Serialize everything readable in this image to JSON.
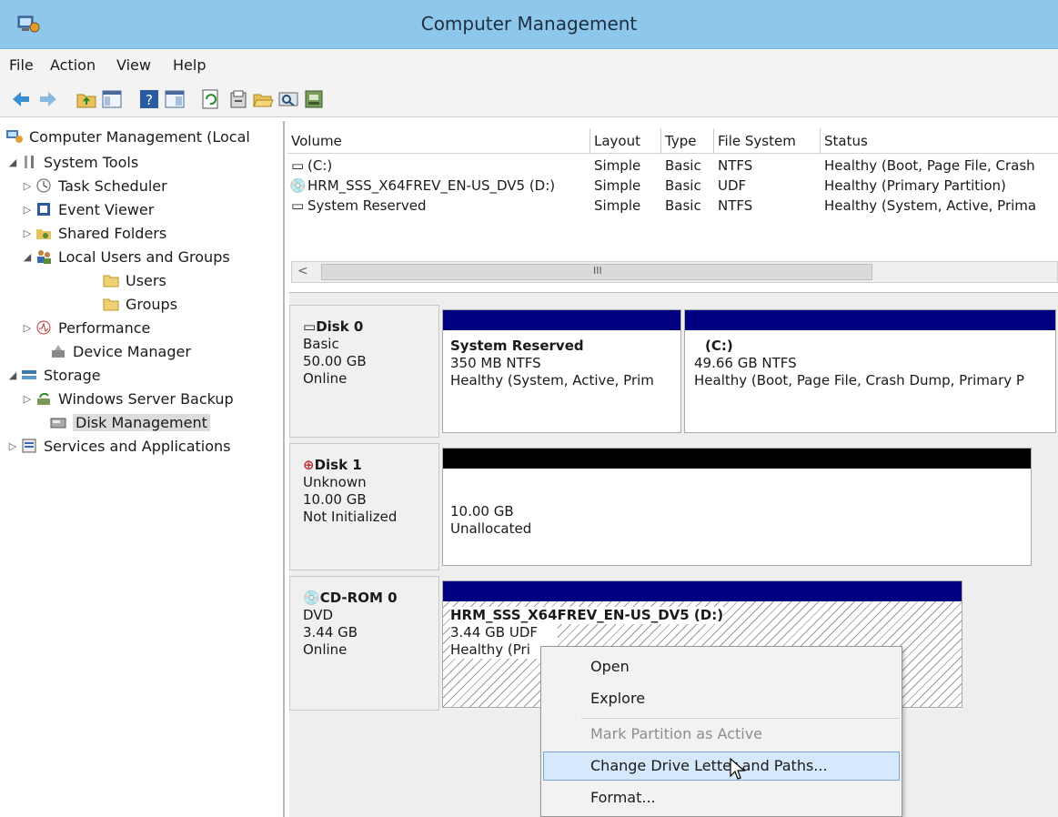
{
  "window": {
    "title": "Computer Management",
    "icon": "computer-management-icon"
  },
  "menu": [
    "File",
    "Action",
    "View",
    "Help"
  ],
  "toolbar": [
    "back-arrow-icon",
    "forward-arrow-icon",
    "up-folder-icon",
    "show-hide-tree-icon",
    "help-icon",
    "properties-pane-icon",
    "refresh-icon",
    "properties-icon",
    "open-icon",
    "search-icon",
    "disk-settings-icon"
  ],
  "tree": [
    {
      "label": "Computer Management (Local",
      "icon": "computer-management-icon",
      "arrow": ""
    },
    {
      "label": "System Tools",
      "icon": "tools-icon",
      "arrow": "expanded"
    },
    {
      "label": "Task Scheduler",
      "icon": "clock-icon",
      "arrow": "collapsed"
    },
    {
      "label": "Event Viewer",
      "icon": "event-viewer-icon",
      "arrow": "collapsed"
    },
    {
      "label": "Shared Folders",
      "icon": "shared-folder-icon",
      "arrow": "collapsed"
    },
    {
      "label": "Local Users and Groups",
      "icon": "users-icon",
      "arrow": "expanded"
    },
    {
      "label": "Users",
      "icon": "folder-icon",
      "arrow": ""
    },
    {
      "label": "Groups",
      "icon": "folder-icon",
      "arrow": ""
    },
    {
      "label": "Performance",
      "icon": "performance-icon",
      "arrow": "collapsed"
    },
    {
      "label": "Device Manager",
      "icon": "device-manager-icon",
      "arrow": ""
    },
    {
      "label": "Storage",
      "icon": "storage-icon",
      "arrow": "expanded"
    },
    {
      "label": "Windows Server Backup",
      "icon": "backup-icon",
      "arrow": "collapsed"
    },
    {
      "label": "Disk Management",
      "icon": "disk-management-icon",
      "arrow": "",
      "selected": true
    },
    {
      "label": "Services and Applications",
      "icon": "services-icon",
      "arrow": "collapsed"
    }
  ],
  "volumes": {
    "headers": [
      "Volume",
      "Layout",
      "Type",
      "File System",
      "Status"
    ],
    "rows": [
      {
        "volume": "(C:)",
        "layout": "Simple",
        "type": "Basic",
        "fs": "NTFS",
        "status": "Healthy (Boot, Page File, Crash"
      },
      {
        "volume": "HRM_SSS_X64FREV_EN-US_DV5 (D:)",
        "layout": "Simple",
        "type": "Basic",
        "fs": "UDF",
        "status": "Healthy (Primary Partition)"
      },
      {
        "volume": "System Reserved",
        "layout": "Simple",
        "type": "Basic",
        "fs": "NTFS",
        "status": "Healthy (System, Active, Prima"
      }
    ],
    "scroll_grip": "III"
  },
  "disks": [
    {
      "name": "Disk 0",
      "type": "Basic",
      "size": "50.00 GB",
      "state": "Online",
      "partitions": [
        {
          "name": "System Reserved",
          "detail": "350 MB NTFS",
          "status": "Healthy (System, Active, Prim"
        },
        {
          "name": "(C:)",
          "detail": "49.66 GB NTFS",
          "status": "Healthy (Boot, Page File, Crash Dump, Primary P"
        }
      ]
    },
    {
      "name": "Disk 1",
      "type": "Unknown",
      "size": "10.00 GB",
      "state": "Not Initialized",
      "partitions": [
        {
          "name": "",
          "detail": "10.00 GB",
          "status": "Unallocated"
        }
      ]
    },
    {
      "name": "CD-ROM 0",
      "type": "DVD",
      "size": "3.44 GB",
      "state": "Online",
      "partitions": [
        {
          "name": "HRM_SSS_X64FREV_EN-US_DV5  (D:)",
          "detail": "3.44 GB UDF",
          "status": "Healthy (Pri"
        }
      ]
    }
  ],
  "context_menu": {
    "items": [
      "Open",
      "Explore",
      "Mark Partition as Active",
      "Change Drive Letter and Paths...",
      "Format..."
    ],
    "disabled": "Mark Partition as Active",
    "highlighted": "Change Drive Letter and Paths..."
  },
  "colors": {
    "titlebar": "#8ec7ec",
    "partition_band_blue": "#000080",
    "unallocated_band": "#000000",
    "menu_highlight": "#d6e8fb"
  }
}
